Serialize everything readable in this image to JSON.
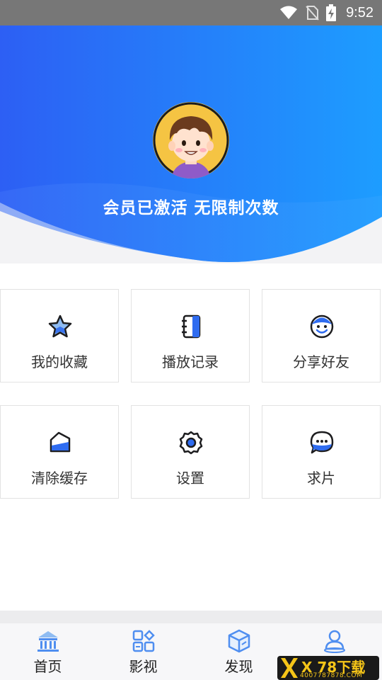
{
  "status_bar": {
    "time": "9:52",
    "icons": [
      "wifi-icon",
      "no-sim-icon",
      "battery-charging-icon"
    ]
  },
  "header": {
    "member_text": "会员已激活 无限制次数",
    "gradient_start": "#2d63f5",
    "gradient_end": "#1e9cff"
  },
  "menu": [
    {
      "label": "我的收藏",
      "icon": "star-icon"
    },
    {
      "label": "播放记录",
      "icon": "notebook-icon"
    },
    {
      "label": "分享好友",
      "icon": "smile-icon"
    },
    {
      "label": "清除缓存",
      "icon": "eraser-icon"
    },
    {
      "label": "设置",
      "icon": "gear-icon"
    },
    {
      "label": "求片",
      "icon": "chat-bubble-icon"
    }
  ],
  "nav": [
    {
      "label": "首页",
      "icon": "home-building-icon"
    },
    {
      "label": "影视",
      "icon": "grid-apps-icon"
    },
    {
      "label": "发现",
      "icon": "discover-cube-icon"
    },
    {
      "label": "",
      "icon": "user-profile-icon"
    }
  ],
  "watermark": {
    "main": "X 78下载",
    "sub": "4007787878.COM"
  },
  "colors": {
    "accent": "#2f6cf0",
    "light_accent": "#8fbcf2"
  }
}
